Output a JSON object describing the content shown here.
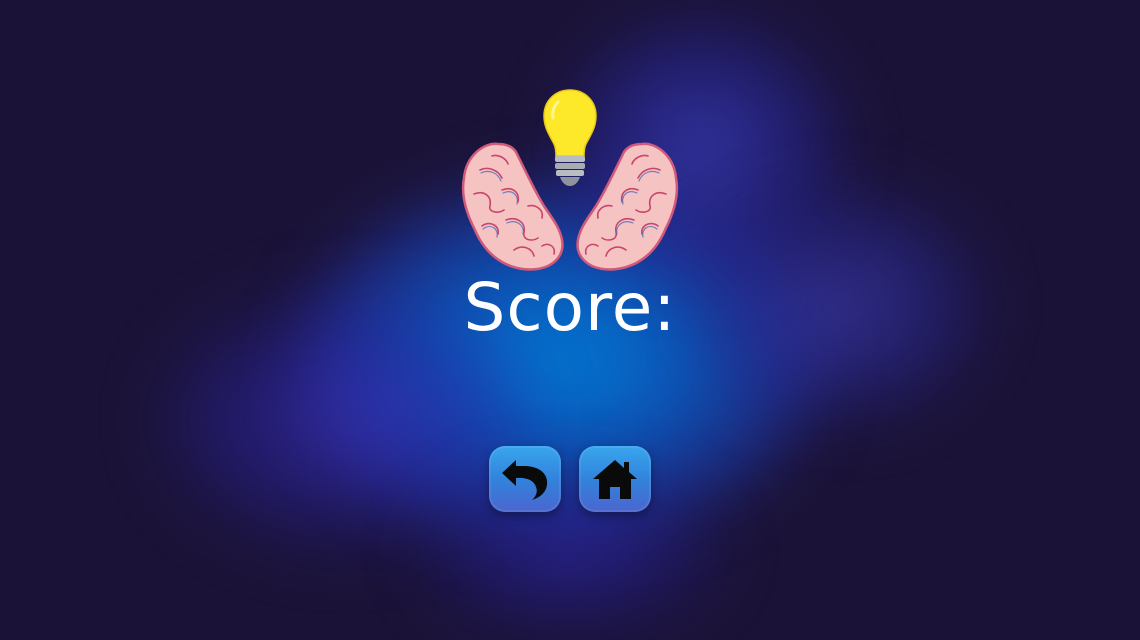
{
  "screen": "game-over",
  "score": {
    "label": "Score:",
    "value": ""
  },
  "buttons": {
    "restart": {
      "icon": "undo-arrow-icon"
    },
    "home": {
      "icon": "home-icon"
    }
  },
  "logo": {
    "icons": [
      "brain-left-half-icon",
      "lightbulb-icon",
      "brain-right-half-icon"
    ]
  },
  "colors": {
    "background": "#1b1337",
    "glow": "#0a78d8",
    "button": "#3a8fe4",
    "bulb": "#fde82a",
    "brain": "#f6c3c3",
    "brain_outline": "#d15a7a",
    "text": "#ffffff"
  }
}
